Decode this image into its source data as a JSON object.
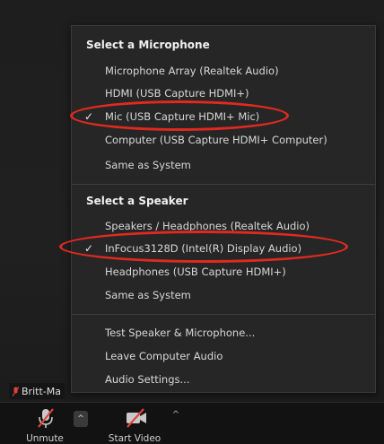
{
  "menu": {
    "microphone_section_title": "Select a Microphone",
    "microphones": [
      {
        "label": "Microphone Array (Realtek Audio)",
        "selected": false
      },
      {
        "label": "HDMI (USB Capture HDMI+)",
        "selected": false
      },
      {
        "label": "Mic (USB Capture HDMI+ Mic)",
        "selected": true
      },
      {
        "label": "Computer (USB Capture HDMI+ Computer)",
        "selected": false
      },
      {
        "label": "Same as System",
        "selected": false
      }
    ],
    "speaker_section_title": "Select a Speaker",
    "speakers": [
      {
        "label": "Speakers / Headphones (Realtek Audio)",
        "selected": false
      },
      {
        "label": "InFocus3128D (Intel(R) Display Audio)",
        "selected": true
      },
      {
        "label": "Headphones (USB Capture HDMI+)",
        "selected": false
      },
      {
        "label": "Same as System",
        "selected": false
      }
    ],
    "actions": [
      {
        "label": "Test Speaker & Microphone..."
      },
      {
        "label": "Leave Computer Audio"
      },
      {
        "label": "Audio Settings..."
      }
    ],
    "check_glyph": "✓"
  },
  "participant": {
    "name": "Britt-Ma"
  },
  "toolbar": {
    "unmute_label": "Unmute",
    "start_video_label": "Start Video",
    "caret_glyph": "^"
  },
  "colors": {
    "annotation": "#e02a20",
    "menu_bg": "#262626",
    "toolbar_bg": "#121212",
    "muted_red": "#e0433a"
  },
  "icons": {
    "muted_microphone": "microphone-muted-icon",
    "video_off": "video-off-icon",
    "check": "check-icon",
    "caret_up": "caret-up-icon"
  }
}
